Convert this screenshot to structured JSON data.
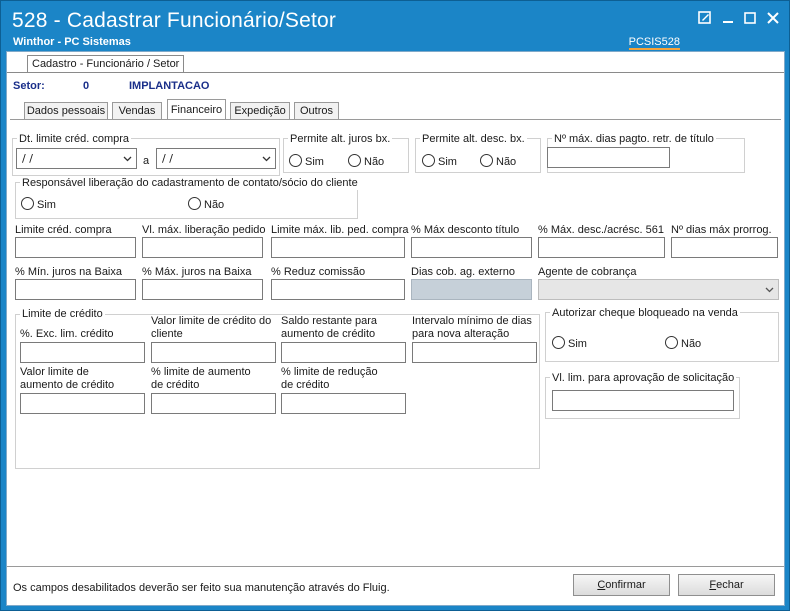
{
  "window": {
    "title": "528 - Cadastrar Funcionário/Setor",
    "subtitle": "Winthor - PC Sistemas",
    "code": "PCSIS528"
  },
  "outer_tab": "Cadastro - Funcionário / Setor",
  "setor": {
    "label": "Setor:",
    "code": "0",
    "name": "IMPLANTACAO"
  },
  "tabs": [
    "Dados pessoais",
    "Vendas",
    "Financeiro",
    "Expedição",
    "Outros"
  ],
  "active_tab": "Financeiro",
  "financeiro": {
    "dt_limite_label": "Dt. limite créd. compra",
    "dt_from": "/ /",
    "dt_sep": "a",
    "dt_to": "/ /",
    "juros_label": "Permite alt. juros bx.",
    "desc_label": "Permite alt. desc. bx.",
    "max_dias_label": "Nº máx. dias pagto. retr. de título",
    "resp_label": "Responsável liberação do cadastramento de contato/sócio do cliente",
    "sim": "Sim",
    "nao": "Não",
    "row1": [
      "Limite créd. compra",
      "Vl. máx. liberação pedido",
      "Limite máx. lib. ped. compra",
      "% Máx desconto título",
      "% Máx. desc./acrésc. 561",
      "Nº dias máx prorrog."
    ],
    "row2": [
      "% Mín. juros na Baixa",
      "% Máx. juros na Baixa",
      "% Reduz  comissão",
      "Dias cob. ag. externo",
      "Agente de cobrança"
    ],
    "limite_group_label": "Limite de crédito",
    "limite_fields": [
      "%. Exc. lim. crédito",
      "Valor limite de crédito do cliente",
      "Saldo restante para aumento de crédito",
      "Intervalo mínimo de dias para nova alteração",
      "Valor limite de aumento de crédito",
      "% limite de aumento de crédito",
      "% limite de redução de crédito"
    ],
    "cheque_label": "Autorizar cheque bloqueado na venda",
    "vl_lim_label": "Vl. lim. para aprovação de solicitação"
  },
  "status_text": "Os campos desabilitados deverão ser feito sua manutenção através do Fluig.",
  "buttons": {
    "confirm_u": "C",
    "confirm_rest": "onfirmar",
    "close_u": "F",
    "close_rest": "echar"
  }
}
